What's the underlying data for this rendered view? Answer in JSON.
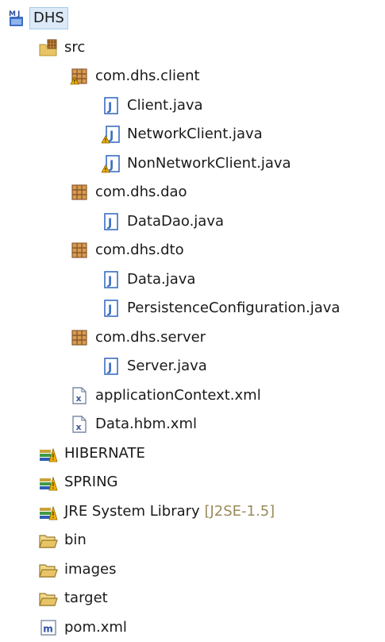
{
  "project": {
    "name": "DHS"
  },
  "src": {
    "label": "src",
    "packages": {
      "client": {
        "label": "com.dhs.client",
        "files": [
          "Client.java",
          "NetworkClient.java",
          "NonNetworkClient.java"
        ]
      },
      "dao": {
        "label": "com.dhs.dao",
        "files": [
          "DataDao.java"
        ]
      },
      "dto": {
        "label": "com.dhs.dto",
        "files": [
          "Data.java",
          "PersistenceConfiguration.java"
        ]
      },
      "server": {
        "label": "com.dhs.server",
        "files": [
          "Server.java"
        ]
      }
    },
    "xml_files": [
      "applicationContext.xml",
      "Data.hbm.xml"
    ]
  },
  "libraries": [
    {
      "label": "HIBERNATE"
    },
    {
      "label": "SPRING"
    },
    {
      "label": "JRE System Library",
      "decoration": "[J2SE-1.5]"
    }
  ],
  "folders": [
    "bin",
    "images",
    "target"
  ],
  "pom": {
    "label": "pom.xml"
  },
  "icons": {
    "project": "maven-java-project-icon",
    "source_folder": "source-folder-icon",
    "package": "package-icon",
    "java_file": "java-file-icon",
    "java_file_warning": "java-file-warning-icon",
    "xml_file": "xml-file-icon",
    "library": "library-icon",
    "folder": "folder-icon",
    "pom_file": "maven-pom-icon"
  },
  "colors": {
    "package": "#8b5a2b",
    "java_file": "#3a6ec2",
    "warning": "#f2b400",
    "folder": "#e8c466",
    "decoration": "#9a8a5a",
    "selection": "#dce9f7"
  }
}
